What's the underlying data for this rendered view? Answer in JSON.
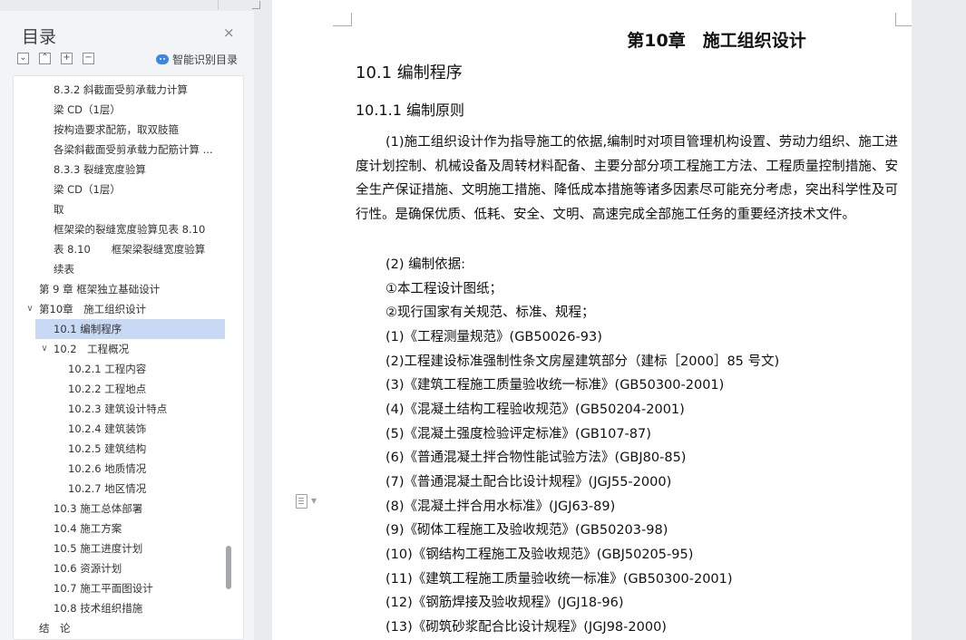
{
  "sidebar": {
    "title": "目录",
    "close_glyph": "×",
    "smart_label": "智能识别目录",
    "toc": [
      {
        "label": "8.3.2 斜截面受剪承载力计算"
      },
      {
        "label": "梁 CD（1层）"
      },
      {
        "label": "按构造要求配筋，取双肢箍"
      },
      {
        "label": "各梁斜截面受剪承载力配筋计算 ..."
      },
      {
        "label": "8.3.3 裂缝宽度验算"
      },
      {
        "label": "梁 CD（1层）"
      },
      {
        "label": "取"
      },
      {
        "label": "框架梁的裂缝宽度验算见表 8.10"
      },
      {
        "label": "表 8.10　　框架梁裂缝宽度验算"
      },
      {
        "label": "续表"
      },
      {
        "label": "第 9 章  框架独立基础设计"
      },
      {
        "label": "第10章　施工组织设计"
      },
      {
        "label": "10.1  编制程序"
      },
      {
        "label": "10.2　工程概况"
      },
      {
        "label": "10.2.1  工程内容"
      },
      {
        "label": "10.2.2  工程地点"
      },
      {
        "label": "10.2.3  建筑设计特点"
      },
      {
        "label": "10.2.4  建筑装饰"
      },
      {
        "label": "10.2.5  建筑结构"
      },
      {
        "label": "10.2.6  地质情况"
      },
      {
        "label": "10.2.7  地区情况"
      },
      {
        "label": "10.3  施工总体部署"
      },
      {
        "label": "10.4  施工方案"
      },
      {
        "label": "10.5  施工进度计划"
      },
      {
        "label": "10.6 资源计划"
      },
      {
        "label": "10.7  施工平面图设计"
      },
      {
        "label": "10.8  技术组织措施"
      },
      {
        "label": "结　论"
      }
    ]
  },
  "document": {
    "chapter_title": "第10章　施工组织设计",
    "section_title": "10.1  编制程序",
    "subsection_title": "10.1.1  编制原则",
    "paragraph": "(1)施工组织设计作为指导施工的依据,编制时对项目管理机构设置、劳动力组织、施工进度计划控制、机械设备及周转材料配备、主要分部分项工程施工方法、工程质量控制措施、安全生产保证措施、文明施工措施、降低成本措施等诸多因素尽可能充分考虑，突出科学性及可行性。是确保优质、低耗、安全、文明、高速完成全部施工任务的重要经济技术文件。",
    "lines": [
      "(2) 编制依据:",
      "①本工程设计图纸；",
      "②现行国家有关规范、标准、规程；",
      "(1)《工程测量规范》(GB50026-93)",
      "(2)工程建设标准强制性条文房屋建筑部分（建标［2000］85 号文)",
      "(3)《建筑工程施工质量验收统一标准》(GB50300-2001)",
      "(4)《混凝土结构工程验收规范》(GB50204-2001)",
      "(5)《混凝土强度检验评定标准》(GB107-87)",
      "(6)《普通混凝土拌合物性能试验方法》(GBJ80-85)",
      "(7)《普通混凝土配合比设计规程》(JGJ55-2000)",
      "(8)《混凝土拌合用水标准》(JGJ63-89)",
      "(9)《砌体工程施工及验收规范》(GB50203-98)",
      "(10)《钢结构工程施工及验收规范》(GBJ50205-95)",
      "(11)《建筑工程施工质量验收统一标准》(GB50300-2001)",
      "(12)《钢筋焊接及验收规程》(JGJ18-96)",
      "(13)《砌筑砂浆配合比设计规程》(JGJ98-2000)"
    ]
  },
  "colors": {
    "selected_bg": "#c7d9f4",
    "smart_icon": "#3b86ee"
  },
  "icons": [
    "close-icon",
    "collapse-all-icon",
    "expand-all-icon",
    "add-icon",
    "remove-icon",
    "smart-toc-icon",
    "document-icon"
  ]
}
